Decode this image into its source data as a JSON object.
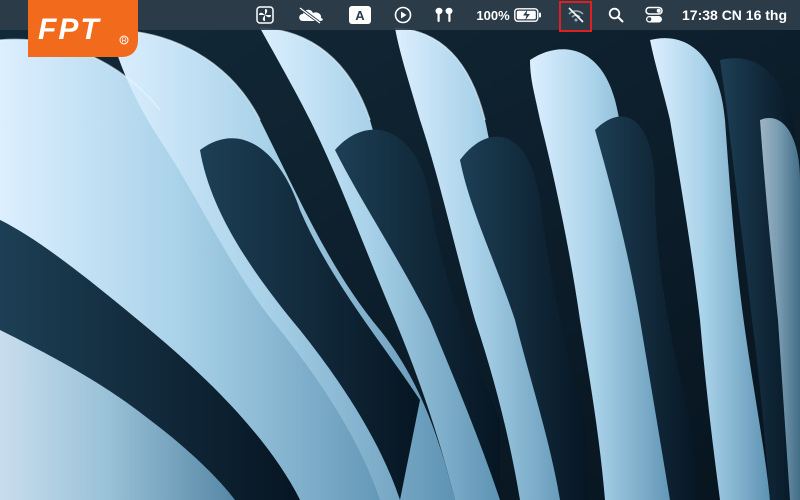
{
  "logo": {
    "text": "FPT",
    "color": "#f26a1b",
    "trademark": "®"
  },
  "menubar": {
    "icons": [
      "fan-control-icon",
      "cloud-offline-icon",
      "input-source-icon",
      "play-circle-icon",
      "airpods-icon",
      "battery-charging-icon",
      "wifi-off-icon",
      "spotlight-search-icon",
      "control-center-icon"
    ],
    "input_source": "A",
    "battery_percent": "100%",
    "clock": "17:38 CN 16 thg"
  },
  "colors": {
    "menubar_bg": "#2e3e4a",
    "highlight": "#e02020",
    "wallpaper_dark": "#0b1f2e",
    "wallpaper_light": "#a7d0e6"
  }
}
